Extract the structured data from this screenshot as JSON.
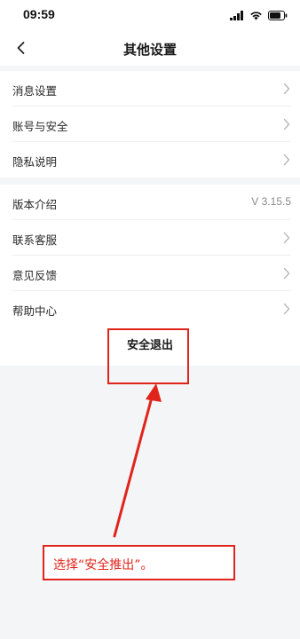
{
  "status_bar": {
    "time": "09:59",
    "icons": [
      "signal-icon",
      "wifi-icon",
      "battery-icon"
    ]
  },
  "nav": {
    "title": "其他设置",
    "back_icon": "chevron-left-icon"
  },
  "section1": {
    "items": [
      {
        "label": "消息设置"
      },
      {
        "label": "账号与安全"
      },
      {
        "label": "隐私说明"
      }
    ]
  },
  "section2": {
    "items": [
      {
        "label": "版本介绍",
        "value": "V 3.15.5"
      },
      {
        "label": "联系客服"
      },
      {
        "label": "意见反馈"
      },
      {
        "label": "帮助中心"
      }
    ]
  },
  "logout": {
    "label": "安全退出"
  },
  "annotation": {
    "callout_text": "选择“安全推出”。",
    "color": "#e0241b"
  }
}
